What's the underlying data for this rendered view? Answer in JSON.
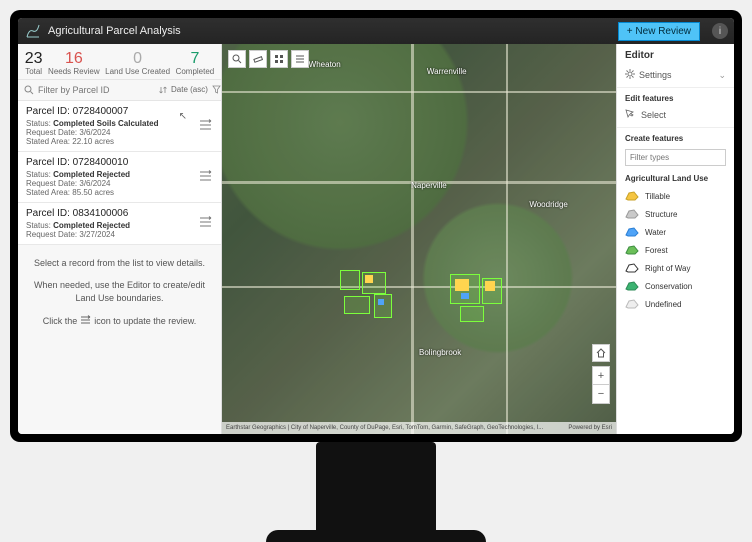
{
  "titlebar": {
    "app_title": "Agricultural Parcel Analysis",
    "new_review_label": "+  New Review"
  },
  "stats": {
    "total": {
      "value": "23",
      "label": "Total"
    },
    "needs": {
      "value": "16",
      "label": "Needs Review"
    },
    "land": {
      "value": "0",
      "label": "Land Use Created"
    },
    "comp": {
      "value": "7",
      "label": "Completed"
    }
  },
  "filter": {
    "placeholder": "Filter by Parcel ID",
    "sort_label": "Date (asc)"
  },
  "parcels": [
    {
      "id_label": "Parcel ID: 0728400007",
      "status_prefix": "Status: ",
      "status_value": "Completed Soils Calculated",
      "request_line": "Request Date: 3/6/2024",
      "area_line": "Stated Area: 22.10 acres",
      "show_cursor": true
    },
    {
      "id_label": "Parcel ID: 0728400010",
      "status_prefix": "Status: ",
      "status_value": "Completed Rejected",
      "request_line": "Request Date: 3/6/2024",
      "area_line": "Stated Area: 85.50 acres",
      "show_cursor": false
    },
    {
      "id_label": "Parcel ID: 0834100006",
      "status_prefix": "Status: ",
      "status_value": "Completed Rejected",
      "request_line": "Request Date: 3/27/2024",
      "area_line": "",
      "show_cursor": false
    }
  ],
  "hints": {
    "line1": "Select a record from the list to view details.",
    "line2": "When needed, use the Editor to create/edit Land Use boundaries.",
    "line3_a": "Click the ",
    "line3_b": " icon to update the review."
  },
  "map": {
    "labels": {
      "naperville": "Naperville",
      "warrenville": "Warrenville",
      "wheaton": "Wheaton",
      "bolingbrook": "Bolingbrook",
      "woodridge": "Woodridge"
    },
    "attribution_left": "Earthstar Geographics | City of Naperville, County of DuPage, Esri, TomTom, Garmin, SafeGraph, GeoTechnologies, I...",
    "attribution_right": "Powered by Esri"
  },
  "editor": {
    "title": "Editor",
    "settings_label": "Settings",
    "edit_features_label": "Edit features",
    "select_label": "Select",
    "create_features_label": "Create features",
    "filter_types_placeholder": "Filter types",
    "category_label": "Agricultural Land Use",
    "types": [
      {
        "name": "Tillable",
        "fill": "#f5c542",
        "stroke": "#c9a227"
      },
      {
        "name": "Structure",
        "fill": "#c9c9c9",
        "stroke": "#9a9a9a"
      },
      {
        "name": "Water",
        "fill": "#4fa3f7",
        "stroke": "#2b7fd4"
      },
      {
        "name": "Forest",
        "fill": "#6bbf59",
        "stroke": "#3e8e41"
      },
      {
        "name": "Right of Way",
        "fill": "#ffffff",
        "stroke": "#333333"
      },
      {
        "name": "Conservation",
        "fill": "#3cb371",
        "stroke": "#2e8b57"
      },
      {
        "name": "Undefined",
        "fill": "#eeeeee",
        "stroke": "#bbbbbb"
      }
    ]
  }
}
